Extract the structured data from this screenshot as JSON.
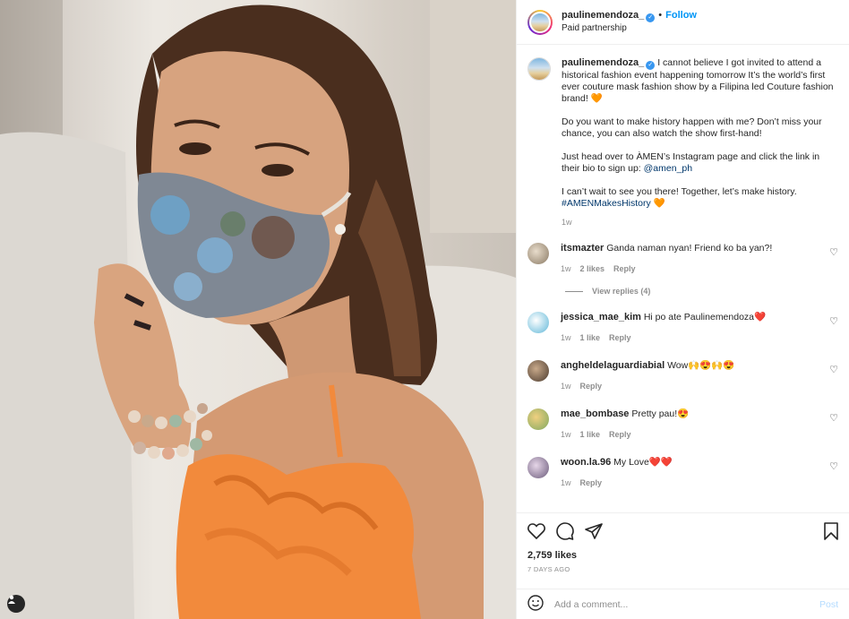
{
  "header": {
    "username": "paulinemendoza_",
    "follow_label": "Follow",
    "dot": "•",
    "subtitle": "Paid partnership"
  },
  "caption": {
    "username": "paulinemendoza_",
    "para1": "I cannot believe I got invited to attend a historical fashion event happening tomorrow It’s the world’s first ever couture mask fashion show by a Filipina led Couture fashion brand! 🧡",
    "para2": "Do you want to make history happen with me? Don’t miss your chance, you can also watch the show first-hand!",
    "para3_text": "Just head over to ÀMEN’s Instagram page and click the link in their bio to sign up: ",
    "para3_link": "@amen_ph",
    "para4_text": "I can’t wait to see you there! Together, let’s make history. ",
    "para4_tag": "#AMENMakesHistory",
    "para4_emoji": " 🧡",
    "time": "1w"
  },
  "comments": [
    {
      "username": "itsmazter",
      "text": "Ganda naman nyan! Friend ko ba yan?!",
      "time": "1w",
      "likes": "2 likes",
      "reply": "Reply",
      "view_replies": "View replies (4)"
    },
    {
      "username": "jessica_mae_kim",
      "text": "Hi po ate Paulinemendoza❤️",
      "time": "1w",
      "likes": "1 like",
      "reply": "Reply"
    },
    {
      "username": "angheldelaguardiabial",
      "text": "Wow🙌😍🙌😍",
      "time": "1w",
      "reply": "Reply"
    },
    {
      "username": "mae_bombase",
      "text": "Pretty pau!😍",
      "time": "1w",
      "likes": "1 like",
      "reply": "Reply"
    },
    {
      "username": "woon.la.96",
      "text": "My Love❤️❤️",
      "time": "1w",
      "reply": "Reply"
    }
  ],
  "actions": {
    "likes": "2,759 likes",
    "ago": "7 DAYS AGO"
  },
  "add_comment": {
    "placeholder": "Add a comment...",
    "post_label": "Post"
  },
  "colors": {
    "accent": "#0095f6",
    "text": "#262626",
    "muted": "#8e8e8e",
    "link": "#00376b",
    "dress": "#f28a3c"
  }
}
